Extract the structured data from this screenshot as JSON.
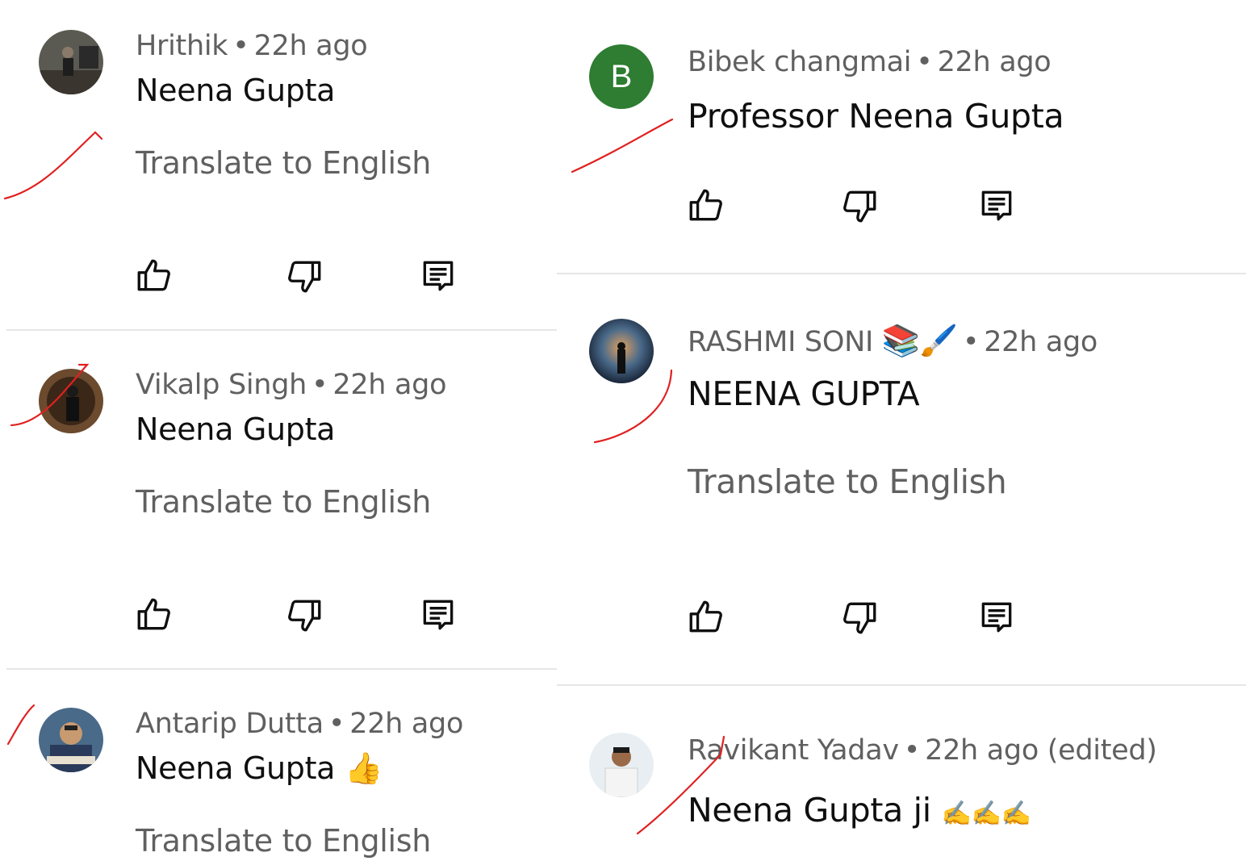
{
  "comments": [
    {
      "author": "Hrithik",
      "time": "22h ago",
      "text": "Neena Gupta",
      "translate": "Translate to English",
      "avatar": "photo"
    },
    {
      "author": "Vikalp Singh",
      "time": "22h ago",
      "text": "Neena Gupta",
      "translate": "Translate to English",
      "avatar": "photo"
    },
    {
      "author": "Antarip Dutta",
      "time": "22h ago",
      "text": "Neena Gupta",
      "emoji": "👍",
      "translate": "Translate to English",
      "avatar": "photo"
    },
    {
      "author": "Bibek changmai",
      "time": "22h ago",
      "text": "Professor Neena Gupta",
      "avatar_letter": "B",
      "avatar_color": "#2e7d32"
    },
    {
      "author": "RASHMI SONI",
      "author_emoji": "📚🖌️",
      "time": "22h ago",
      "text": "NEENA GUPTA",
      "translate": "Translate to English",
      "avatar": "photo"
    },
    {
      "author": "Ravikant Yadav",
      "time": "22h ago (edited)",
      "text": "Neena Gupta ji",
      "emoji": "✍️✍️✍️",
      "avatar": "photo"
    }
  ],
  "separator": "•",
  "icons": {
    "like": "thumb-up-icon",
    "dislike": "thumb-down-icon",
    "reply": "reply-icon"
  },
  "annotation_color": "#e02020"
}
